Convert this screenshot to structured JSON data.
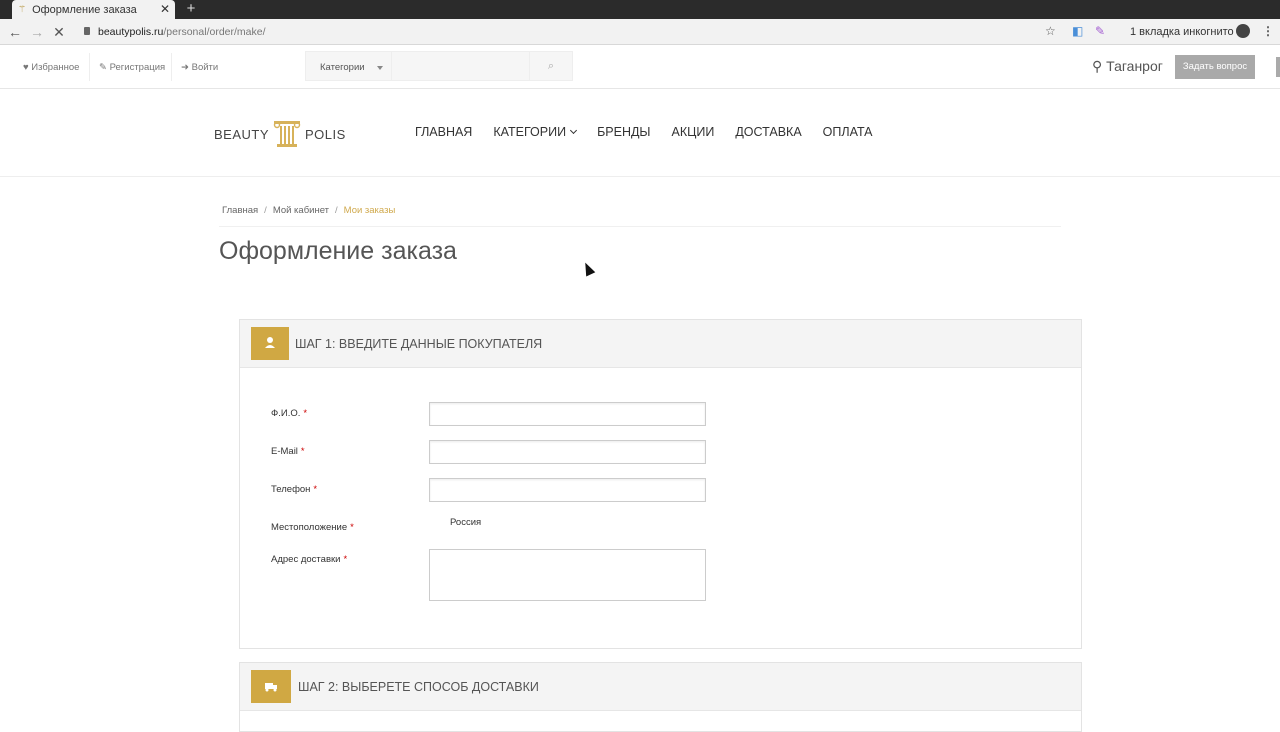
{
  "browser": {
    "tab_title": "Оформление заказа",
    "url_domain": "beautypolis.ru",
    "url_path": "/personal/order/make/",
    "incognito_label": "1 вкладка инкогнито"
  },
  "topbar": {
    "favorites": "Избранное",
    "register": "Регистрация",
    "login": "Войти",
    "categories_select": "Категории",
    "search_placeholder": "",
    "city": "Таганрог",
    "ask_button": "Задать вопрос"
  },
  "logo": {
    "left": "BEAUTY",
    "right": "POLIS"
  },
  "nav": {
    "home": "ГЛАВНАЯ",
    "categories": "КАТЕГОРИИ",
    "brands": "БРЕНДЫ",
    "sales": "АКЦИИ",
    "delivery": "ДОСТАВКА",
    "payment": "ОПЛАТА"
  },
  "breadcrumb": {
    "home": "Главная",
    "cabinet": "Мой кабинет",
    "current": "Мои заказы",
    "separator": "/"
  },
  "page_title": "Оформление заказа",
  "step1": {
    "title": "ШАГ 1: ВВЕДИТЕ ДАННЫЕ ПОКУПАТЕЛЯ",
    "icon": "user-icon",
    "fields": {
      "fio": "Ф.И.О.",
      "email": "E-Mail",
      "phone": "Телефон",
      "location": "Местоположение",
      "address": "Адрес доставки"
    },
    "location_value": "Россия",
    "required_mark": "*"
  },
  "step2": {
    "title": "ШАГ 2: ВЫБЕРЕТЕ СПОСОБ ДОСТАВКИ",
    "icon": "truck-icon"
  },
  "colors": {
    "accent": "#d0a843",
    "breadcrumb_active": "#d0a94d",
    "required": "#cc0000"
  }
}
